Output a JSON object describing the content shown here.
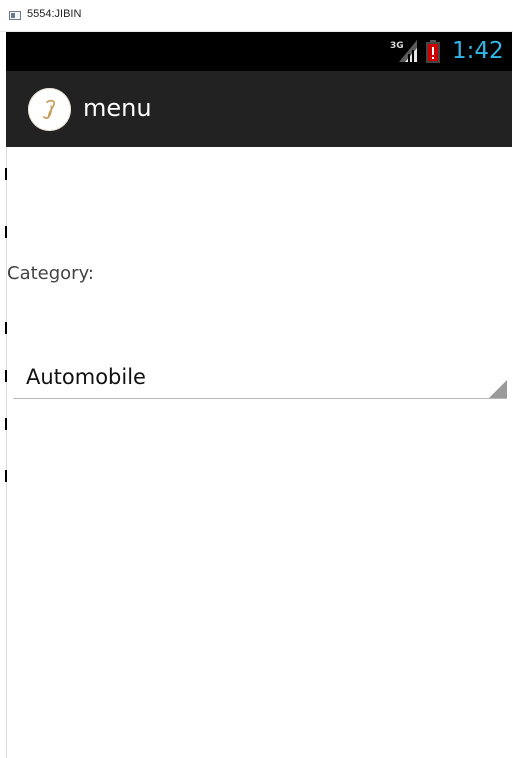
{
  "window": {
    "title": "5554:JIBIN"
  },
  "status_bar": {
    "network": "3G",
    "time": "1:42",
    "colors": {
      "time": "#33b5e5",
      "battery_alert": "#cc0000"
    }
  },
  "action_bar": {
    "title": "menu",
    "icon": "app-logo-icon"
  },
  "form": {
    "category_label": "Category:",
    "category_selected": "Automobile"
  }
}
